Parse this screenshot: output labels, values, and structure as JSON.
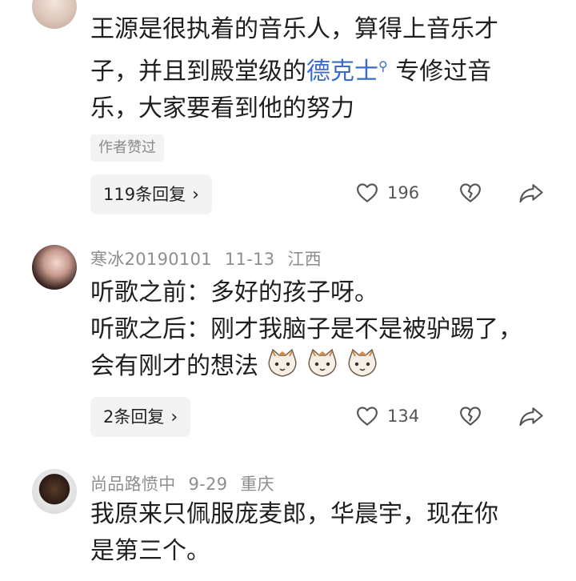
{
  "comments": [
    {
      "text_line1": "王源是很执着的音乐人，算得上音乐才",
      "text_line2_a": "子，并且到殿堂级的",
      "text_line2_link": "德克士",
      "text_line2_b": " 专修过音",
      "text_line3": "乐，大家要看到他的努力",
      "tag": "作者赞过",
      "reply_label": "119条回复",
      "likes": "196"
    },
    {
      "username": "寒冰20190101",
      "date": "11-13",
      "location": "江西",
      "line1": "听歌之前：多好的孩子呀。",
      "line2": "听歌之后：刚才我脑子是不是被驴踢了，",
      "line3": "会有刚才的想法",
      "reply_label": "2条回复",
      "likes": "134"
    },
    {
      "username": "尚品路愤中",
      "date": "9-29",
      "location": "重庆",
      "line1": "我原来只佩服庞麦郎，华晨宇，现在你",
      "line2": "是第三个。"
    }
  ],
  "icons": {
    "like": "heart-outline-icon",
    "dislike": "broken-heart-icon",
    "share": "share-arrow-icon",
    "reply_chevron": "chevron-right-icon",
    "search_mark": "search-icon",
    "emoji": "cat-face-emoji"
  },
  "colors": {
    "link": "#3a6cc7",
    "meta": "#8e8e8e",
    "pill_bg": "#f3f3f3"
  }
}
